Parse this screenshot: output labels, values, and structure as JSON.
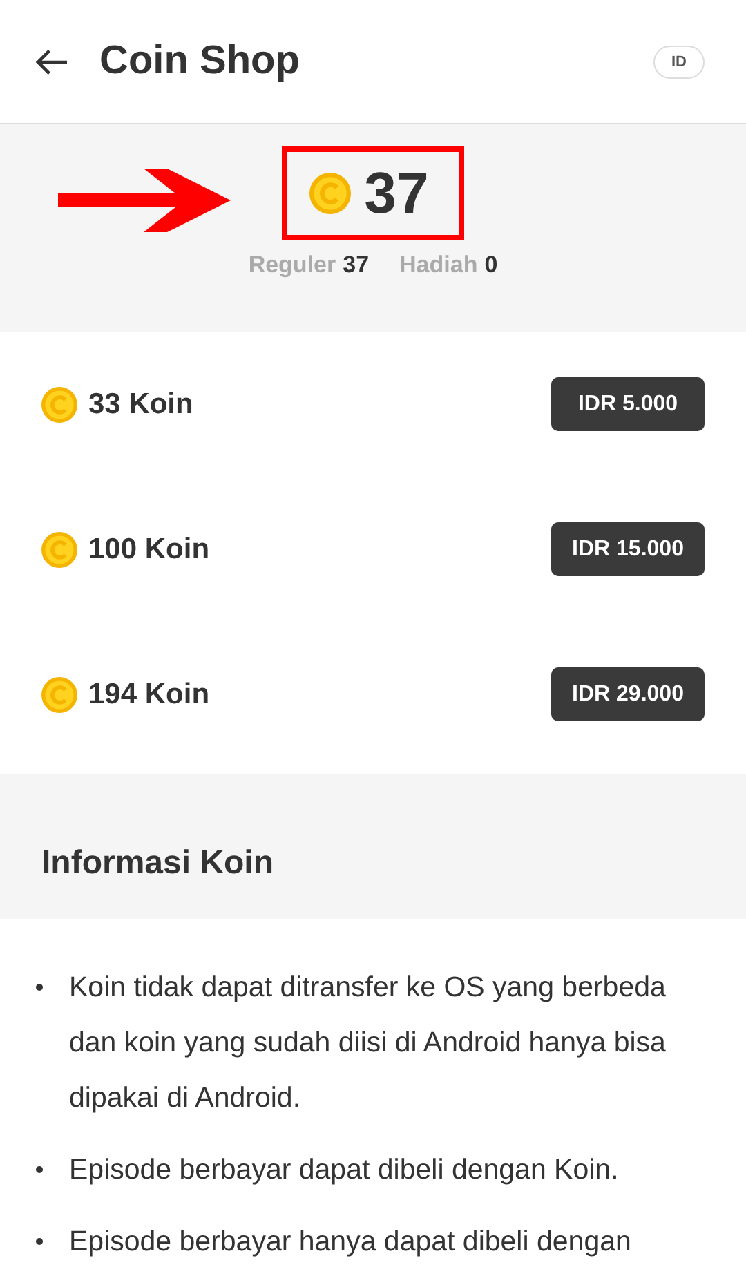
{
  "header": {
    "title": "Coin Shop",
    "language_badge": "ID"
  },
  "balance": {
    "total": "37",
    "highlighted": true,
    "regular_label": "Reguler",
    "regular_value": "37",
    "bonus_label": "Hadiah",
    "bonus_value": "0"
  },
  "packages": [
    {
      "amount": "33 Koin",
      "price": "IDR 5.000"
    },
    {
      "amount": "100 Koin",
      "price": "IDR 15.000"
    },
    {
      "amount": "194 Koin",
      "price": "IDR 29.000"
    }
  ],
  "info": {
    "title": "Informasi Koin",
    "items": [
      "Koin tidak dapat ditransfer ke OS yang berbeda dan koin yang sudah diisi di Android hanya bisa dipakai di Android.",
      "Episode berbayar dapat dibeli dengan Koin.",
      "Episode berbayar hanya dapat dibeli dengan"
    ]
  }
}
